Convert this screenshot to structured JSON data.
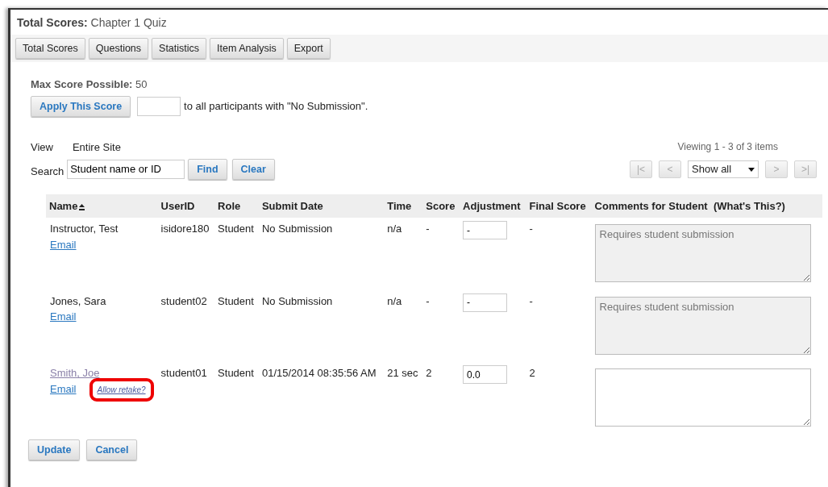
{
  "page": {
    "title_label": "Total Scores:",
    "title": "Chapter 1 Quiz"
  },
  "tabs": [
    {
      "label": "Total Scores"
    },
    {
      "label": "Questions"
    },
    {
      "label": "Statistics"
    },
    {
      "label": "Item Analysis"
    },
    {
      "label": "Export"
    }
  ],
  "max_score": {
    "label": "Max Score Possible:",
    "value": "50"
  },
  "apply": {
    "button": "Apply This Score",
    "text": "to all participants with \"No Submission\"."
  },
  "view": {
    "label": "View",
    "value": "Entire Site"
  },
  "search": {
    "label": "Search",
    "value": "Student name or ID",
    "find": "Find",
    "clear": "Clear"
  },
  "pager": {
    "summary": "Viewing 1 - 3 of 3 items",
    "first": "|<",
    "prev": "<",
    "page_size": "Show all",
    "next": ">",
    "last": ">|",
    "disabled": true
  },
  "table": {
    "columns": [
      {
        "label": "Name",
        "sorted": true
      },
      {
        "label": "UserID",
        "sorted": false
      },
      {
        "label": "Role",
        "sorted": false
      },
      {
        "label": "Submit Date",
        "sorted": false
      },
      {
        "label": "Time",
        "sorted": false
      },
      {
        "label": "Score",
        "sorted": false
      },
      {
        "label": "Adjustment",
        "sorted": false
      },
      {
        "label": "Final Score",
        "sorted": false
      },
      {
        "label": "Comments for Student",
        "sorted": false,
        "help": "(What's This?)"
      }
    ],
    "rows": [
      {
        "name": "Instructor, Test",
        "name_link": false,
        "email": "Email",
        "userid": "isidore180",
        "role": "Student",
        "submit_date": "No Submission",
        "time": "n/a",
        "score": "-",
        "adjustment": "-",
        "final_score": "-",
        "comment_placeholder": "Requires student submission",
        "comment_disabled": true
      },
      {
        "name": "Jones, Sara",
        "name_link": false,
        "email": "Email",
        "userid": "student02",
        "role": "Student",
        "submit_date": "No Submission",
        "time": "n/a",
        "score": "-",
        "adjustment": "-",
        "final_score": "-",
        "comment_placeholder": "Requires student submission",
        "comment_disabled": true
      },
      {
        "name": "Smith, Joe",
        "name_link": true,
        "email": "Email",
        "retake": "Allow retake?",
        "retake_highlighted": true,
        "userid": "student01",
        "role": "Student",
        "submit_date": "01/15/2014 08:35:56 AM",
        "time": "21 sec",
        "score": "2",
        "adjustment": "0.0",
        "final_score": "2",
        "comment_disabled": false
      }
    ]
  },
  "buttons": [
    {
      "label": "Update"
    },
    {
      "label": "Cancel"
    }
  ]
}
